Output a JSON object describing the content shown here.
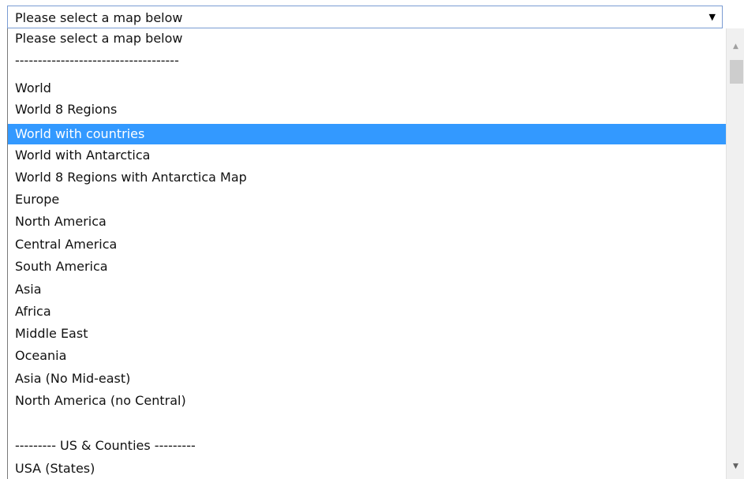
{
  "select": {
    "value": "Please select a map below",
    "arrow": "▼"
  },
  "dropdown": {
    "options": [
      "Please select a map below",
      "------------------------------------",
      "World",
      "World 8 Regions",
      "World with countries",
      "World with Antarctica",
      "World 8 Regions with Antarctica Map",
      "Europe",
      "North America",
      "Central America",
      "South America",
      "Asia",
      "Africa",
      "Middle East",
      "Oceania",
      "Asia (No Mid-east)",
      "North America (no Central)",
      "",
      "--------- US & Counties ---------",
      "USA (States)"
    ],
    "selected_index": 4
  },
  "scrollbar": {
    "up_arrow": "▲",
    "down_arrow": "▼"
  },
  "colors": {
    "highlight": "#3399ff",
    "highlight_text": "#ffffff",
    "select_border": "#7a9cd3"
  }
}
